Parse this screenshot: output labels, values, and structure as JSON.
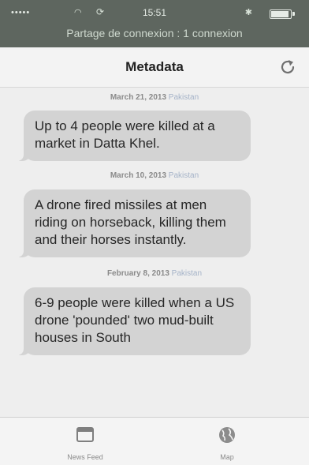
{
  "status_bar": {
    "signal": "•••••",
    "time": "15:51",
    "hotspot": "Partage de connexion : 1 connexion"
  },
  "nav": {
    "title": "Metadata",
    "refresh_icon": "refresh-icon"
  },
  "feed": [
    {
      "date": "March 21, 2013",
      "country": "Pakistan",
      "text": "Up to 4 people were killed at a market in Datta Khel."
    },
    {
      "date": "March 10, 2013",
      "country": "Pakistan",
      "text": "A drone fired missiles at men riding on horseback, killing them and their horses instantly."
    },
    {
      "date": "February 8, 2013",
      "country": "Pakistan",
      "text": "6-9 people were killed when a US drone 'pounded' two mud-built houses in South"
    }
  ],
  "tabs": [
    {
      "label": "News Feed",
      "icon": "news-feed-icon"
    },
    {
      "label": "Map",
      "icon": "globe-icon"
    }
  ],
  "colors": {
    "status_bar": "#5e665f",
    "bubble": "#d3d3d3",
    "background": "#eeeeee",
    "country": "#a5b3c8"
  }
}
